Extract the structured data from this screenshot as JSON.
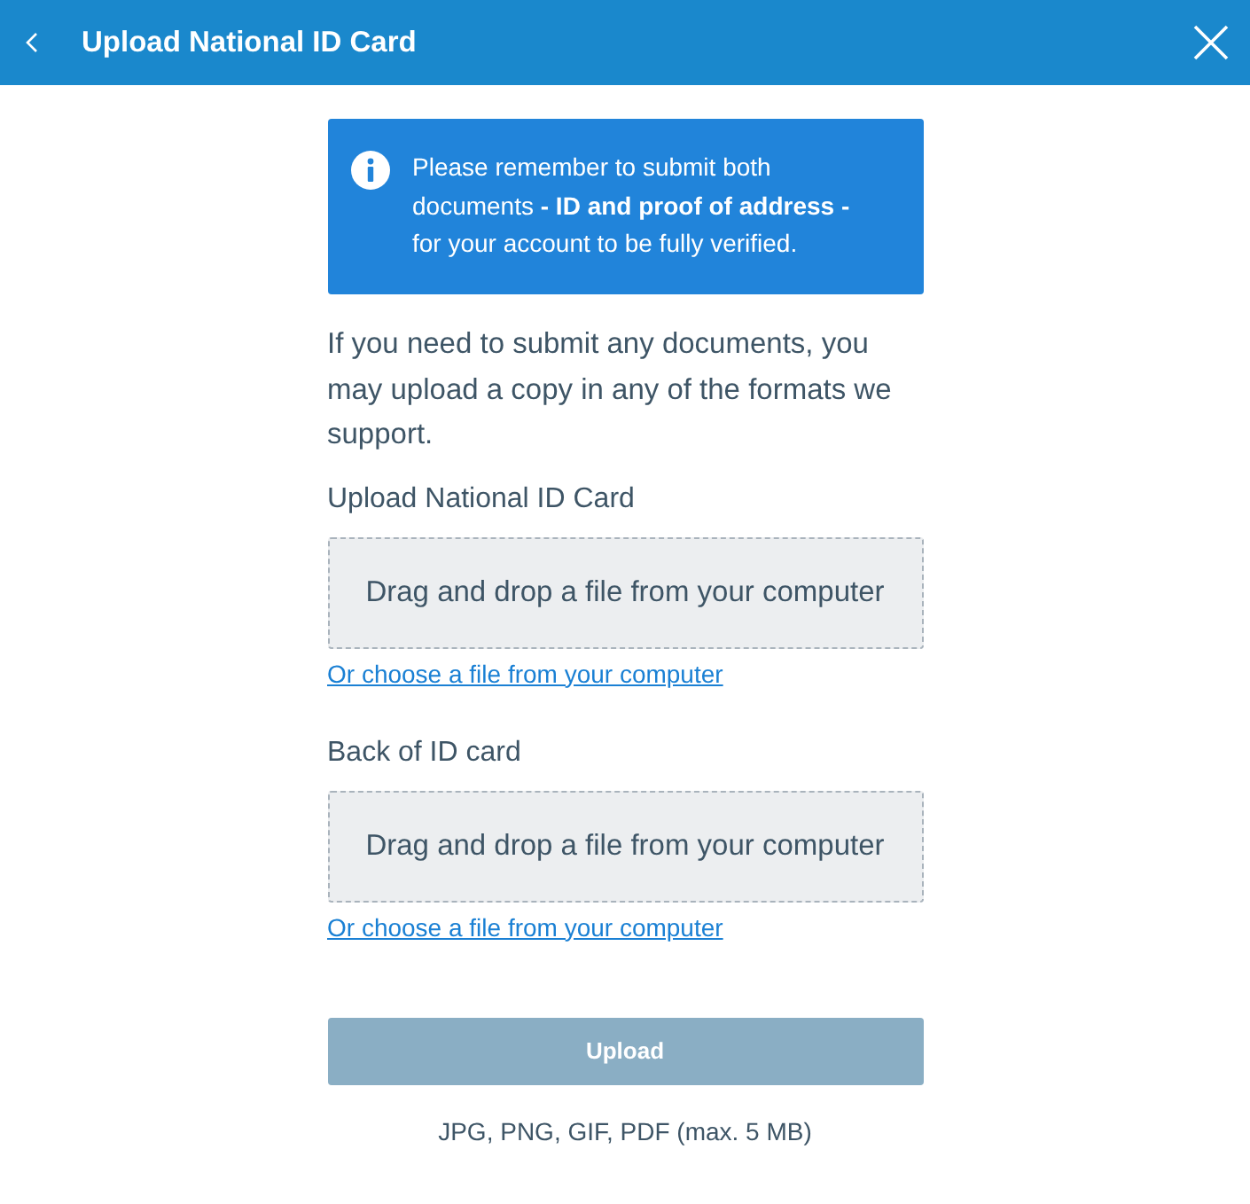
{
  "header": {
    "title": "Upload National ID Card"
  },
  "notice": {
    "text": "Please remember to submit both documents **- ID and proof of address -** for your account to be fully verified."
  },
  "intro": "If you need to submit any documents, you may upload a copy in any of the formats we support.",
  "uploads": [
    {
      "label": "Upload National ID Card",
      "dropzone": "Drag and drop a file from your computer",
      "link": "Or choose a file from your computer"
    },
    {
      "label": "Back of ID card",
      "dropzone": "Drag and drop a file from your computer",
      "link": "Or choose a file from your computer"
    }
  ],
  "submit": {
    "label": "Upload",
    "disabled": true
  },
  "formats": "JPG, PNG, GIF, PDF (max. 5 MB)"
}
